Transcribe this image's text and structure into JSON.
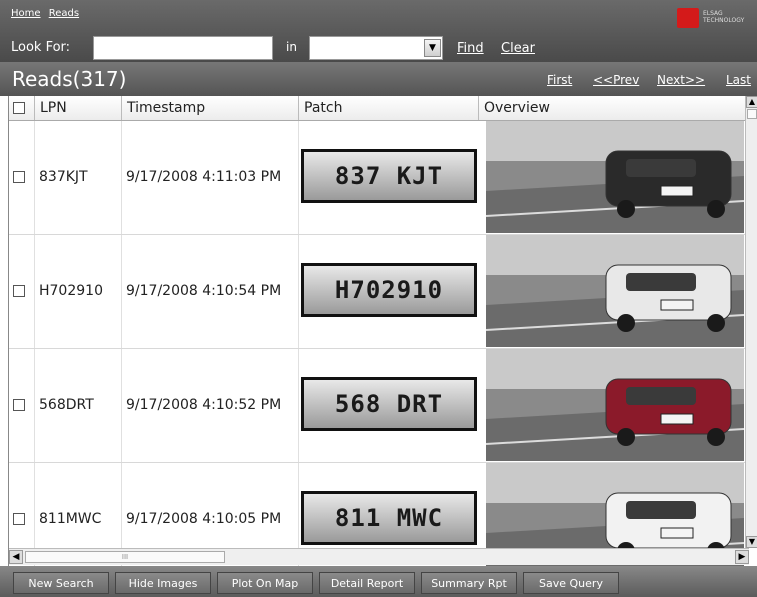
{
  "breadcrumb": {
    "home": "Home",
    "reads": "Reads"
  },
  "logo": {
    "text_line1": "ELSAG",
    "text_line2": "TECHNOLOGY",
    "color": "#d41a1a"
  },
  "search": {
    "look_for_label": "Look For:",
    "look_for_value": "",
    "in_label": "in",
    "field_value": "",
    "find": "Find",
    "clear": "Clear"
  },
  "reads": {
    "title": "Reads(317)",
    "first": "First",
    "prev": "<<Prev",
    "next": "Next>>",
    "last": "Last"
  },
  "columns": {
    "lpn": "LPN",
    "timestamp": "Timestamp",
    "patch": "Patch",
    "overview": "Overview"
  },
  "rows": [
    {
      "lpn": "837KJT",
      "timestamp": "9/17/2008 4:11:03 PM",
      "plate_text": "837 KJT",
      "car_color": "#2a2a2a"
    },
    {
      "lpn": "H702910",
      "timestamp": "9/17/2008 4:10:54 PM",
      "plate_text": "H702910",
      "car_color": "#e8e8e8"
    },
    {
      "lpn": "568DRT",
      "timestamp": "9/17/2008 4:10:52 PM",
      "plate_text": "568 DRT",
      "car_color": "#8b1a2a"
    },
    {
      "lpn": "811MWC",
      "timestamp": "9/17/2008 4:10:05 PM",
      "plate_text": "811 MWC",
      "car_color": "#f2f2f2"
    }
  ],
  "buttons": {
    "new_search": "New Search",
    "hide_images": "Hide Images",
    "plot_on_map": "Plot On Map",
    "detail_report": "Detail Report",
    "summary_rpt": "Summary Rpt",
    "save_query": "Save Query"
  }
}
